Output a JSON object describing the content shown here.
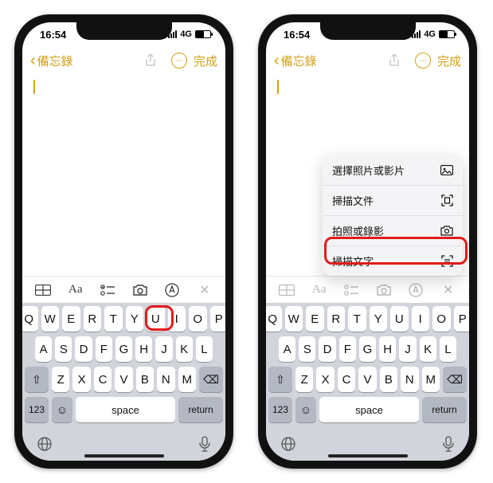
{
  "status": {
    "time": "16:54",
    "network": "4G"
  },
  "nav": {
    "back_label": "備忘錄",
    "done_label": "完成"
  },
  "menu": {
    "item0": "選擇照片或影片",
    "item1": "掃描文件",
    "item2": "拍照或錄影",
    "item3": "掃描文字"
  },
  "toolbar": {
    "aa": "Aa"
  },
  "keyboard": {
    "r1": [
      "Q",
      "W",
      "E",
      "R",
      "T",
      "Y",
      "U",
      "I",
      "O",
      "P"
    ],
    "r2": [
      "A",
      "S",
      "D",
      "F",
      "G",
      "H",
      "J",
      "K",
      "L"
    ],
    "r3": [
      "Z",
      "X",
      "C",
      "V",
      "B",
      "N",
      "M"
    ],
    "k123": "123",
    "space": "space",
    "return": "return"
  }
}
